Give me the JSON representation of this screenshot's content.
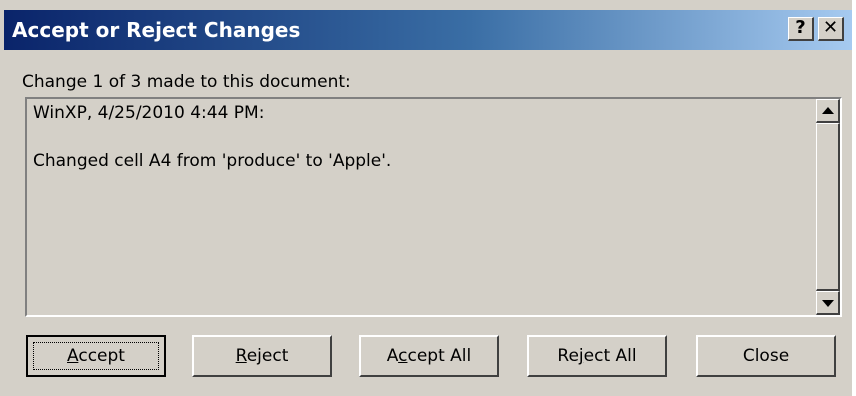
{
  "dialog": {
    "title": "Accept or Reject Changes",
    "help_glyph": "?",
    "close_glyph": "✕"
  },
  "prompt": "Change 1 of 3 made to this document:",
  "details": {
    "author_line": "WinXP, 4/25/2010 4:44 PM:",
    "change_line": "Changed cell A4 from 'produce' to 'Apple'."
  },
  "buttons": {
    "accept": {
      "before": "",
      "mnemonic": "A",
      "after": "ccept"
    },
    "reject": {
      "before": "",
      "mnemonic": "R",
      "after": "eject"
    },
    "accept_all": {
      "before": "A",
      "mnemonic": "c",
      "after": "cept All"
    },
    "reject_all": {
      "before": "Re",
      "mnemonic": "j",
      "after": "ect All"
    },
    "close": {
      "label": "Close"
    }
  },
  "colors": {
    "title_start": "#0a246a",
    "title_end": "#a6caf0",
    "face": "#d4d0c8"
  },
  "icons": {
    "scroll_up": "triangle-up-icon",
    "scroll_down": "triangle-down-icon"
  }
}
